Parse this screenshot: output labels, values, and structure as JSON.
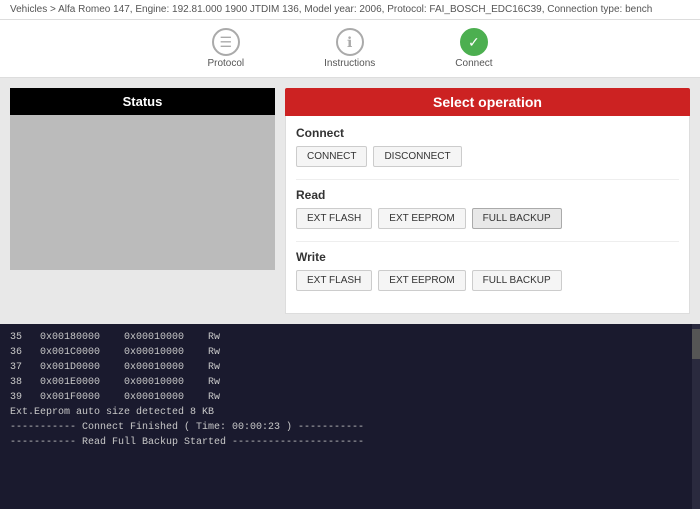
{
  "breadcrumb": {
    "text": "Vehicles  >  Alfa Romeo 147, Engine: 192.81.000 1900 JTDIM 136, Model year: 2006, Protocol: FAI_BOSCH_EDC16C39, Connection type: bench"
  },
  "steps": [
    {
      "label": "Protocol",
      "icon": "☰",
      "state": "inactive"
    },
    {
      "label": "Instructions",
      "icon": "ℹ",
      "state": "inactive"
    },
    {
      "label": "Connect",
      "icon": "✓",
      "state": "active"
    }
  ],
  "left_panel": {
    "header": "Status"
  },
  "right_panel": {
    "header": "Select operation",
    "sections": [
      {
        "title": "Connect",
        "buttons": [
          "CONNECT",
          "DISCONNECT"
        ]
      },
      {
        "title": "Read",
        "buttons": [
          "EXT FLASH",
          "EXT EEPROM",
          "FULL BACKUP"
        ]
      },
      {
        "title": "Write",
        "buttons": [
          "EXT FLASH",
          "EXT EEPROM",
          "FULL BACKUP"
        ]
      }
    ]
  },
  "terminal": {
    "lines": [
      "35   0x00180000    0x00010000    Rw",
      "36   0x001C0000    0x00010000    Rw",
      "37   0x001D0000    0x00010000    Rw",
      "38   0x001E0000    0x00010000    Rw",
      "39   0x001F0000    0x00010000    Rw",
      "",
      "Ext.Eeprom auto size detected 8 KB",
      "",
      "----------- Connect Finished ( Time: 00:00:23 ) -----------",
      "",
      "----------- Read Full Backup Started ----------------------"
    ]
  },
  "colors": {
    "red": "#cc2222",
    "black": "#000000",
    "green": "#4caf50"
  }
}
